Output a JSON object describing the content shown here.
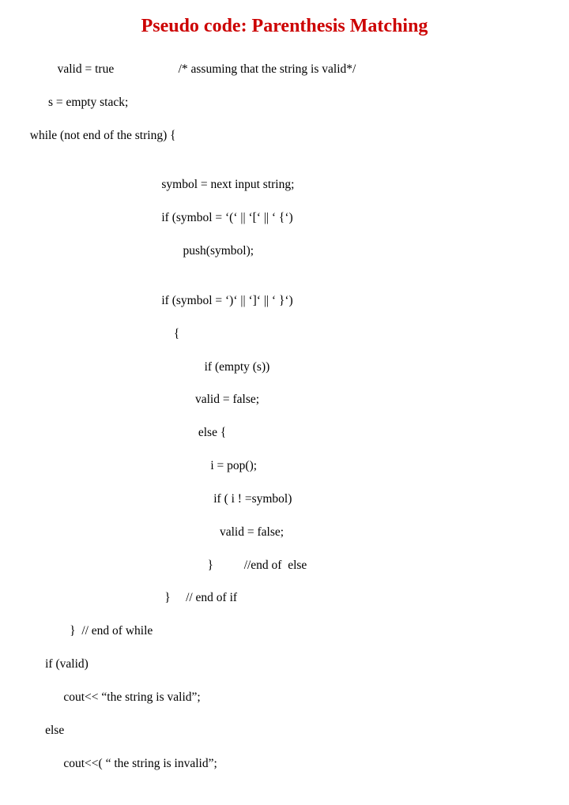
{
  "title": "Pseudo code:  Parenthesis Matching",
  "lines": {
    "l0": "           valid = true                     /* assuming that the string is valid*/",
    "l1": "        s = empty stack;",
    "l2": "  while (not end of the string) {",
    "l3": "",
    "l4": "                                             symbol = next input string;",
    "l5": "                                             if (symbol = ‘(‘ || ‘[‘ || ‘ {‘)",
    "l6": "                                                    push(symbol);",
    "l7": "",
    "l8": "                                             if (symbol = ‘)‘ || ‘]‘ || ‘ }‘)",
    "l9": "                                                 {",
    "l10": "                                                           if (empty (s))",
    "l11": "                                                        valid = false;",
    "l12": "                                                         else {",
    "l13": "                                                             i = pop();",
    "l14": "                                                              if ( i ! =symbol)",
    "l15": "                                                                valid = false;",
    "l16": "                                                            }          //end of  else",
    "l17": "                                              }     // end of if",
    "l18": "               }  // end of while",
    "l19": "       if (valid)",
    "l20": "             cout<< “the string is valid”;",
    "l21": "       else",
    "l22": "             cout<<( “ the string is invalid”;"
  }
}
